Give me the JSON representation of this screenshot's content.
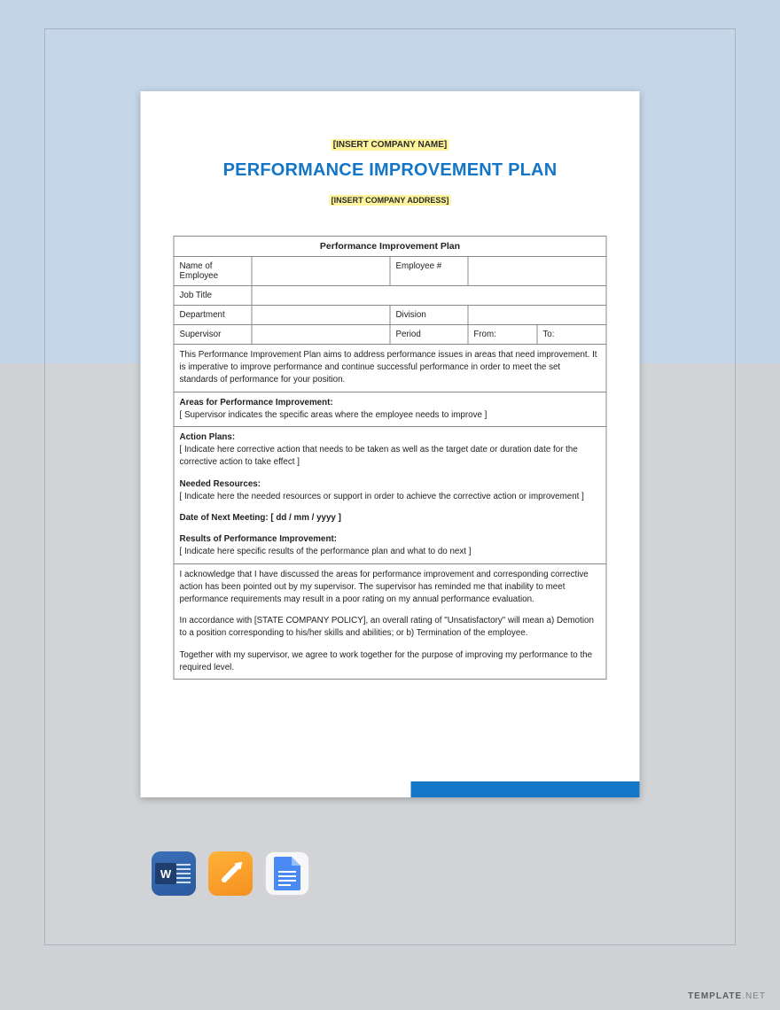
{
  "header": {
    "company_name": "[INSERT COMPANY NAME]",
    "title": "PERFORMANCE IMPROVEMENT PLAN",
    "company_address": "[INSERT COMPANY ADDRESS]"
  },
  "table": {
    "title": "Performance Improvement Plan",
    "row1": {
      "name_of_employee": "Name of Employee",
      "employee_no": "Employee #"
    },
    "row2": {
      "job_title": "Job Title"
    },
    "row3": {
      "department": "Department",
      "division": "Division"
    },
    "row4": {
      "supervisor": "Supervisor",
      "period": "Period",
      "from": "From:",
      "to": "To:"
    },
    "intro": "This Performance Improvement Plan aims to address performance issues in areas that need improvement. It is imperative to improve performance and continue successful performance in order to meet the set standards of performance for your position.",
    "areas_h": "Areas for Performance Improvement:",
    "areas_t": "[ Supervisor indicates the specific areas where the employee needs to improve ]",
    "action_h": "Action Plans:",
    "action_t": "[ Indicate here corrective action that needs to be taken as well as the target date or duration date for the corrective action to take effect ]",
    "resources_h": "Needed Resources:",
    "resources_t": "[ Indicate here the needed resources or support in order to achieve the corrective action or improvement ]",
    "meeting_h": "Date of Next Meeting: [ dd / mm / yyyy ]",
    "results_h": "Results of Performance Improvement:",
    "results_t": "[ Indicate here specific results of the performance plan and what to do next ]",
    "ack1": "I acknowledge that I have discussed the areas for performance improvement and corresponding corrective action has been pointed out by my supervisor. The supervisor has reminded me that inability to meet performance requirements may result in a poor rating on my annual performance evaluation.",
    "ack2": "In accordance with [STATE COMPANY POLICY], an overall rating of \"Unsatisfactory\" will mean a) Demotion to a position corresponding to his/her skills and abilities; or b) Termination of the employee.",
    "ack3": "Together with my supervisor, we agree to work together for the purpose of improving my performance to the required level."
  },
  "icons": {
    "word": "W",
    "word_name": "Microsoft Word",
    "pages_name": "Apple Pages",
    "docs_name": "Google Docs"
  },
  "watermark": {
    "brand": "TEMPLATE",
    "suffix": ".NET"
  }
}
